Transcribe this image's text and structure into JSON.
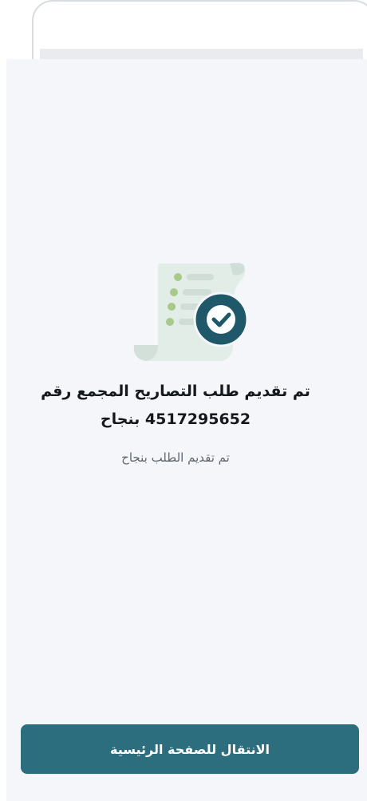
{
  "success": {
    "title": "تم تقديم طلب التصاريح المجمع رقم 4517295652 بنجاح",
    "subtitle": "تم تقديم الطلب بنجاح"
  },
  "actions": {
    "home_button_label": "الانتقال للصفحة الرئيسية"
  },
  "icons": {
    "illustration": "receipt-check-icon"
  },
  "colors": {
    "primary": "#2c6e7e",
    "check_badge": "#1f5868",
    "list_dot": "#a7c98a",
    "paper": "#e3ede8",
    "background": "#f4f6fa"
  }
}
